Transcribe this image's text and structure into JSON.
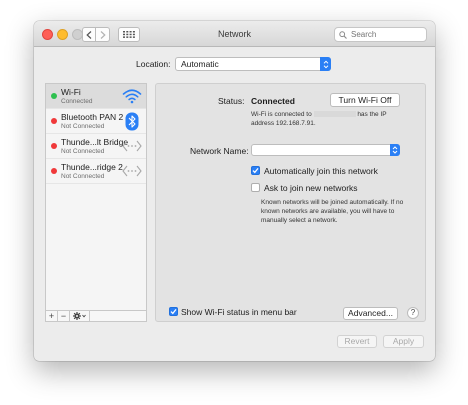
{
  "window": {
    "title": "Network",
    "search_placeholder": "Search"
  },
  "location": {
    "label": "Location:",
    "value": "Automatic"
  },
  "services": [
    {
      "name": "Wi-Fi",
      "status": "Connected",
      "indicator": "green",
      "icon": "wifi-icon",
      "selected": true
    },
    {
      "name": "Bluetooth PAN 2",
      "status": "Not Connected",
      "indicator": "red",
      "icon": "bluetooth-icon",
      "selected": false
    },
    {
      "name": "Thunde...lt Bridge",
      "status": "Not Connected",
      "indicator": "red",
      "icon": "thunderbolt-bridge-icon",
      "selected": false
    },
    {
      "name": "Thunde...ridge 2",
      "status": "Not Connected",
      "indicator": "red",
      "icon": "thunderbolt-bridge-icon",
      "selected": false
    }
  ],
  "sidebar_controls": {
    "add": "+",
    "remove": "−",
    "actions_icon": "gear-icon"
  },
  "detail": {
    "status_label": "Status:",
    "status_value": "Connected",
    "turn_off_label": "Turn Wi-Fi Off",
    "desc_prefix": "Wi-Fi is connected to",
    "desc_suffix": "has the IP address 192.168.7.91.",
    "network_name_label": "Network Name:",
    "network_name_value": "",
    "auto_join_label": "Automatically join this network",
    "auto_join_checked": true,
    "ask_join_label": "Ask to join new networks",
    "ask_join_checked": false,
    "ask_join_hint": "Known networks will be joined automatically. If no known networks are available, you will have to manually select a network.",
    "show_status_label": "Show Wi-Fi status in menu bar",
    "show_status_checked": true,
    "advanced_label": "Advanced...",
    "help_label": "?"
  },
  "footer": {
    "revert_label": "Revert",
    "apply_label": "Apply"
  },
  "colors": {
    "accent": "#2a7ff5",
    "connected": "#2ec04f",
    "disconnected": "#f0393a"
  }
}
